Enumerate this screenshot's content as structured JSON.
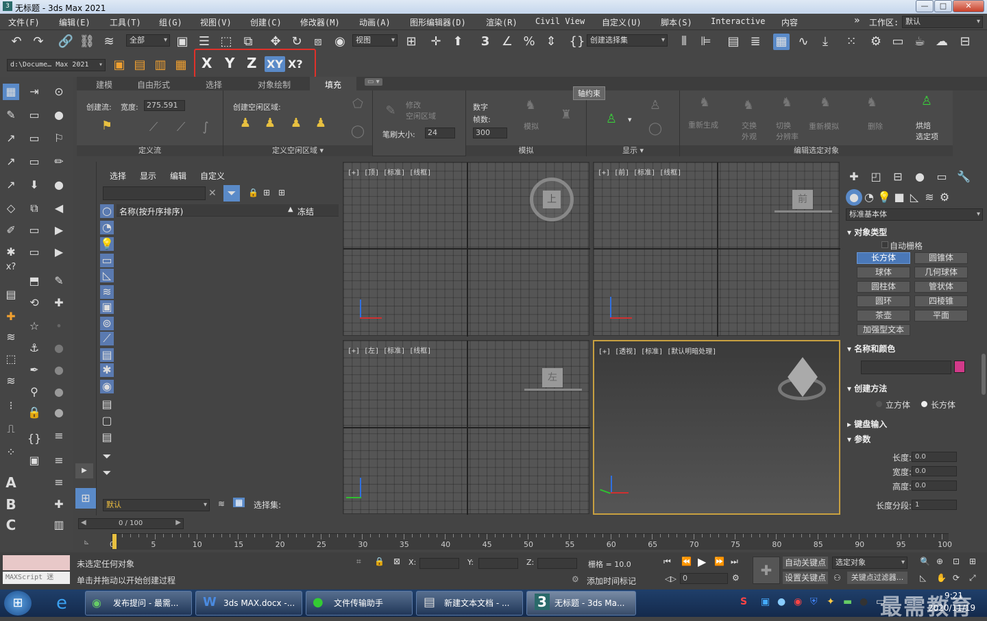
{
  "window": {
    "title": "无标题 - 3ds Max 2021",
    "min": "—",
    "max": "□",
    "close": "✕"
  },
  "menu": [
    "文件(F)",
    "编辑(E)",
    "工具(T)",
    "组(G)",
    "视图(V)",
    "创建(C)",
    "修改器(M)",
    "动画(A)",
    "图形编辑器(D)",
    "渲染(R)",
    "Civil View",
    "自定义(U)",
    "脚本(S)",
    "Interactive",
    "内容"
  ],
  "workspace": {
    "label": "工作区:",
    "value": "默认",
    "chevron": "»"
  },
  "toolbar": {
    "filter": "全部",
    "refcoord": "视图",
    "selset": "创建选择集"
  },
  "toolbar2": {
    "path": "d:\\Docume… Max 2021",
    "axis_x": "X",
    "axis_y": "Y",
    "axis_z": "Z",
    "axis_xy": "XY",
    "axis_xq": "X?"
  },
  "ribbon_tabs": [
    "建模",
    "自由形式",
    "选择",
    "对象绘制",
    "填充"
  ],
  "ribbon": {
    "flow_label": "创建流:",
    "width_label": "宽度:",
    "width_value": "275.591",
    "area_label": "创建空闲区域:",
    "modify_label": "修改\n空闲区域",
    "brush_label": "笔刷大小:",
    "brush_value": "24",
    "num_label": "数字",
    "frames_label": "帧数:",
    "frames_value": "300",
    "simulate_label": "模拟",
    "tooltip": "轴约束",
    "regen": "重新生成",
    "swap": "交换\n外观",
    "cut": "切换\n分辨率",
    "resim": "重新模拟",
    "delete": "删除",
    "bake": "烘焙\n选定项",
    "sections": [
      "定义流",
      "定义空闲区域 ▾",
      "模拟",
      "显示 ▾",
      "编辑选定对象"
    ]
  },
  "explorer": {
    "tabs": [
      "选择",
      "显示",
      "编辑",
      "自定义"
    ],
    "col_name": "名称(按升序排序)",
    "col_sort": "▲",
    "col_freeze": "冻结",
    "layer": "默认",
    "selset_label": "选择集:"
  },
  "viewports": [
    {
      "label": "[+] [顶] [标准] [线框]",
      "cube": "上"
    },
    {
      "label": "[+] [前] [标准] [线框]",
      "cube": "前"
    },
    {
      "label": "[+] [左] [标准] [线框]",
      "cube": "左"
    },
    {
      "label": "[+] [透视] [标准] [默认明暗处理]",
      "cube": ""
    }
  ],
  "command_panel": {
    "category": "标准基本体",
    "object_type": "对象类型",
    "autogrid": "自动栅格",
    "objects": [
      "长方体",
      "圆锥体",
      "球体",
      "几何球体",
      "圆柱体",
      "管状体",
      "圆环",
      "四棱锥",
      "茶壶",
      "平面",
      "加强型文本"
    ],
    "name_color": "名称和颜色",
    "color": "#d23a8a",
    "creation_method": "创建方法",
    "cube": "立方体",
    "box": "长方体",
    "keyboard": "键盘输入",
    "params": "参数",
    "length": "长度:",
    "width": "宽度:",
    "height": "高度:",
    "length_segs": "长度分段:",
    "length_val": "0.0",
    "width_val": "0.0",
    "height_val": "0.0",
    "segs_val": "1"
  },
  "timeline": {
    "frame": "0 / 100",
    "ticks": [
      "0",
      "5",
      "10",
      "15",
      "20",
      "25",
      "30",
      "35",
      "40",
      "45",
      "50",
      "55",
      "60",
      "65",
      "70",
      "75",
      "80",
      "85",
      "90",
      "95",
      "100"
    ]
  },
  "status": {
    "maxscript": "MAXScript 迷",
    "msg1": "未选定任何对象",
    "msg2": "单击并拖动以开始创建过程",
    "x": "X:",
    "y": "Y:",
    "z": "Z:",
    "grid": "栅格 = 10.0",
    "addtime": "添加时间标记",
    "autokey": "自动关键点",
    "setkey": "设置关键点",
    "selobj": "选定对象",
    "keyfilter": "关键点过滤器...",
    "frame": "0"
  },
  "taskbar": {
    "items": [
      "发布提问 - 最需...",
      "3ds MAX.docx -...",
      "文件传输助手",
      "新建文本文档 - ...",
      "无标题 - 3ds Ma..."
    ],
    "time": "9:21",
    "date": "2020/11/19",
    "watermark": "最需教育"
  }
}
